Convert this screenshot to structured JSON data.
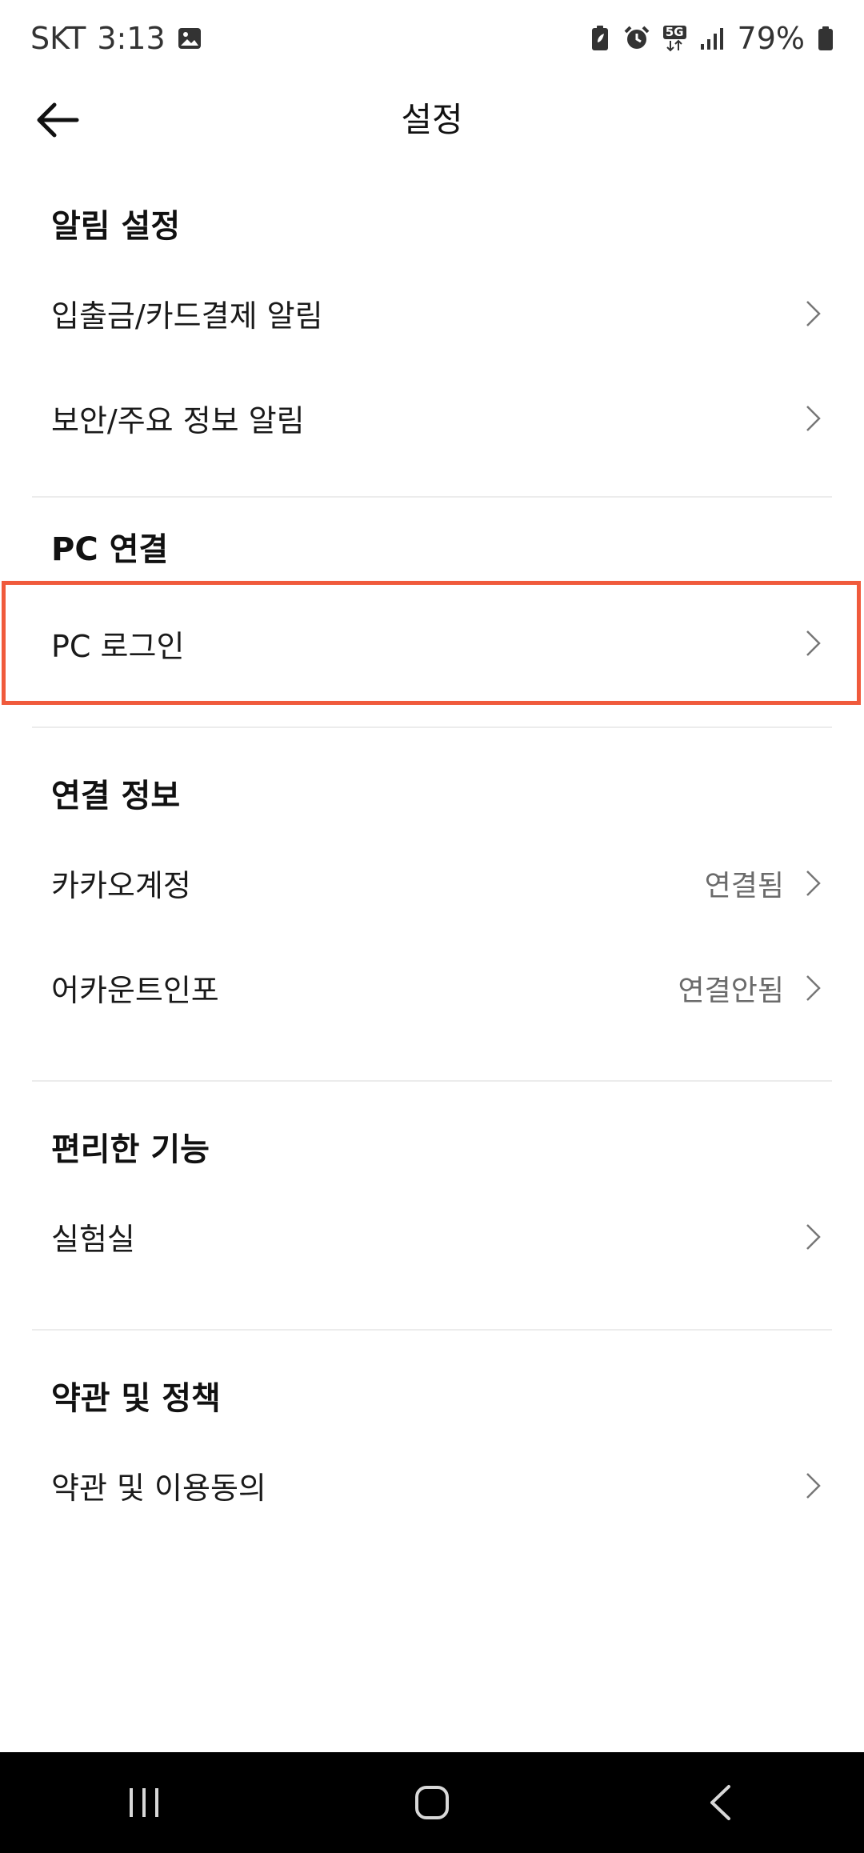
{
  "status_bar": {
    "carrier": "SKT",
    "time": "3:13",
    "network": "5G",
    "battery": "79%"
  },
  "header": {
    "title": "설정"
  },
  "sections": [
    {
      "title": "알림 설정",
      "items": [
        {
          "label": "입출금/카드결제 알림",
          "value": ""
        },
        {
          "label": "보안/주요 정보 알림",
          "value": ""
        }
      ]
    },
    {
      "title": "PC 연결",
      "items": [
        {
          "label": "PC 로그인",
          "value": ""
        }
      ]
    },
    {
      "title": "연결 정보",
      "items": [
        {
          "label": "카카오계정",
          "value": "연결됨"
        },
        {
          "label": "어카운트인포",
          "value": "연결안됨"
        }
      ]
    },
    {
      "title": "편리한 기능",
      "items": [
        {
          "label": "실험실",
          "value": ""
        }
      ]
    },
    {
      "title": "약관 및 정책",
      "items": [
        {
          "label": "약관 및 이용동의",
          "value": ""
        }
      ]
    }
  ],
  "colors": {
    "highlight_border": "#f05a3c",
    "navbar_background": "#000000"
  },
  "icons": {
    "back": "arrow-left-icon",
    "chevron": "chevron-right-icon",
    "recents": "recent-apps-icon",
    "home": "home-icon",
    "nav_back": "nav-back-icon"
  }
}
